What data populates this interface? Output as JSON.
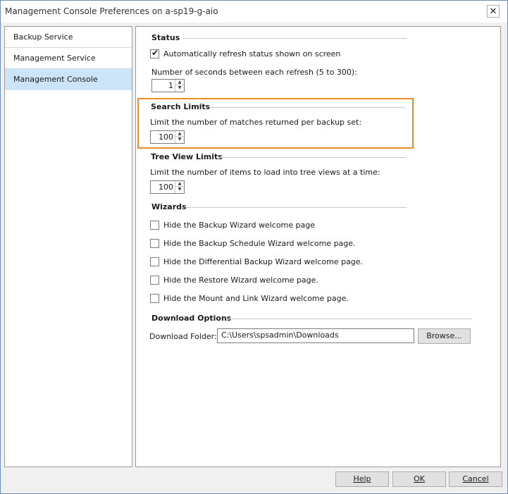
{
  "window": {
    "title": "Management Console Preferences on a-sp19-g-aio",
    "close_glyph": "✕"
  },
  "sidebar": {
    "items": [
      {
        "label": "Backup Service"
      },
      {
        "label": "Management Service"
      },
      {
        "label": "Management Console",
        "selected": true
      }
    ]
  },
  "status": {
    "heading": "Status",
    "auto_refresh_label": "Automatically refresh status shown on screen",
    "auto_refresh_checked": true,
    "seconds_label": "Number of seconds between each refresh (5 to 300):",
    "seconds_value": "1"
  },
  "search_limits": {
    "heading": "Search Limits",
    "label": "Limit the number of matches returned per backup set:",
    "value": "100"
  },
  "tree_view_limits": {
    "heading": "Tree View Limits",
    "label": "Limit the number of items to load into tree views at a time:",
    "value": "100"
  },
  "wizards": {
    "heading": "Wizards",
    "items": [
      {
        "label": "Hide the Backup Wizard welcome page"
      },
      {
        "label": "Hide the Backup Schedule Wizard welcome page."
      },
      {
        "label": "Hide the Differential Backup Wizard welcome page."
      },
      {
        "label": "Hide the Restore Wizard welcome page."
      },
      {
        "label": "Hide the Mount and Link Wizard welcome page."
      }
    ]
  },
  "download_options": {
    "heading": "Download Options",
    "folder_label": "Download Folder:",
    "folder_value": "C:\\Users\\spsadmin\\Downloads",
    "browse_label": "Browse..."
  },
  "footer": {
    "help_label": "Help",
    "ok_label": "OK",
    "cancel_label": "Cancel"
  },
  "colors": {
    "highlight": "#ee8a2a",
    "selected": "#cce4f7"
  }
}
